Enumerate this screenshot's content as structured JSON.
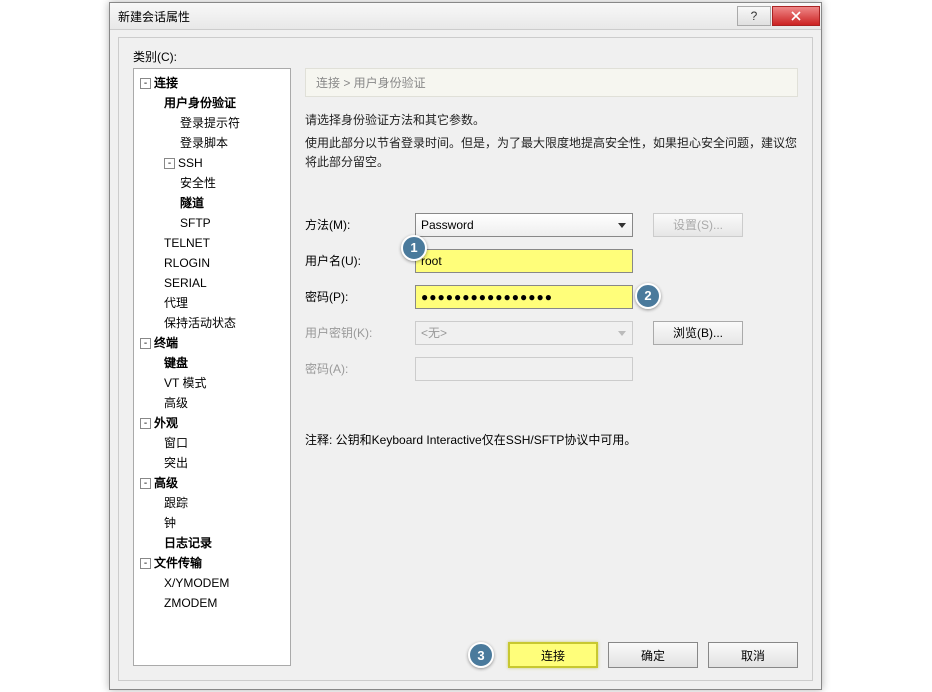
{
  "window": {
    "title": "新建会话属性"
  },
  "category_label": "类别(C):",
  "tree": {
    "connection": {
      "label": "连接",
      "user_auth": "用户身份验证",
      "login_prompt": "登录提示符",
      "login_script": "登录脚本",
      "ssh": "SSH",
      "ssh_security": "安全性",
      "ssh_tunnel": "隧道",
      "ssh_sftp": "SFTP",
      "telnet": "TELNET",
      "rlogin": "RLOGIN",
      "serial": "SERIAL",
      "proxy": "代理",
      "keepalive": "保持活动状态"
    },
    "terminal": {
      "label": "终端",
      "keyboard": "键盘",
      "vt": "VT 模式",
      "advanced": "高级"
    },
    "appearance": {
      "label": "外观",
      "window": "窗口",
      "highlight": "突出"
    },
    "advanced": {
      "label": "高级",
      "trace": "跟踪",
      "bell": "钟",
      "logging": "日志记录"
    },
    "filetransfer": {
      "label": "文件传输",
      "xymodem": "X/YMODEM",
      "zmodem": "ZMODEM"
    }
  },
  "breadcrumb": "连接 > 用户身份验证",
  "desc1": "请选择身份验证方法和其它参数。",
  "desc2": "使用此部分以节省登录时间。但是，为了最大限度地提高安全性，如果担心安全问题，建议您将此部分留空。",
  "form": {
    "method_label": "方法(M):",
    "method_value": "Password",
    "settings_btn": "设置(S)...",
    "username_label": "用户名(U):",
    "username_value": "root",
    "password_label": "密码(P):",
    "password_value": "●●●●●●●●●●●●●●●●",
    "userkey_label": "用户密钥(K):",
    "userkey_value": "<无>",
    "browse_btn": "浏览(B)...",
    "passphrase_label": "密码(A):"
  },
  "note": "注释: 公钥和Keyboard Interactive仅在SSH/SFTP协议中可用。",
  "buttons": {
    "connect": "连接",
    "ok": "确定",
    "cancel": "取消"
  },
  "annotations": {
    "a1": "1",
    "a2": "2",
    "a3": "3"
  }
}
